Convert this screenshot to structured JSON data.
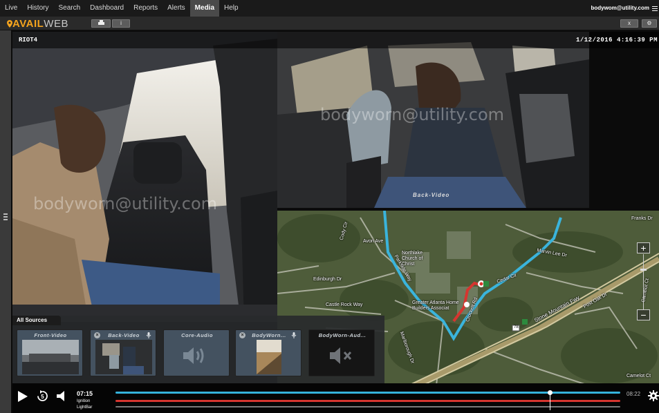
{
  "nav": {
    "items": [
      "Live",
      "History",
      "Search",
      "Dashboard",
      "Reports",
      "Alerts",
      "Media",
      "Help"
    ],
    "active": "Media",
    "user": "bodywom@utility.com"
  },
  "app": {
    "logo_part1": "AVAIL",
    "logo_part2": "WEB",
    "buttons": [
      "print-icon",
      "info-icon"
    ],
    "right_buttons": [
      "close-icon",
      "gear-icon"
    ]
  },
  "video": {
    "device": "RIOT4",
    "timestamp": "1/12/2016 4:16:39 PM",
    "watermark": "bodyworn@utility.com",
    "back_label": "Back-Video"
  },
  "map": {
    "labels": [
      "Avon Ave",
      "Northlake Church of Christ",
      "Edinburgh Dr",
      "Castle Rock Way",
      "Greater Atlanta Home Builders Associat",
      "Marlborough Dr",
      "Crockett Rd",
      "Cedar Cir",
      "Marvin Lee Dr",
      "Parkside Way",
      "Franks Dr",
      "Stone Mountain Fwy",
      "Post Oak Dr",
      "Camelot Ct",
      "Cody Cir",
      "Camelot Ct",
      "78"
    ]
  },
  "sources": {
    "tab": "All Sources",
    "items": [
      {
        "title": "Front-Video",
        "type": "video"
      },
      {
        "title": "Back-Video",
        "type": "video"
      },
      {
        "title": "Core-Audio",
        "type": "audio"
      },
      {
        "title": "BodyWorn...",
        "type": "video"
      },
      {
        "title": "BodyWorn-Aud...",
        "type": "audio-muted"
      }
    ]
  },
  "player": {
    "current_time": "07:15",
    "end_time": "08:22",
    "tracks": [
      "Ignition",
      "LightBar"
    ],
    "progress": 0.86,
    "colors": {
      "video": "#35b3dc",
      "ignition": "#d6352f",
      "lightbar": "#7a7a7a"
    }
  }
}
